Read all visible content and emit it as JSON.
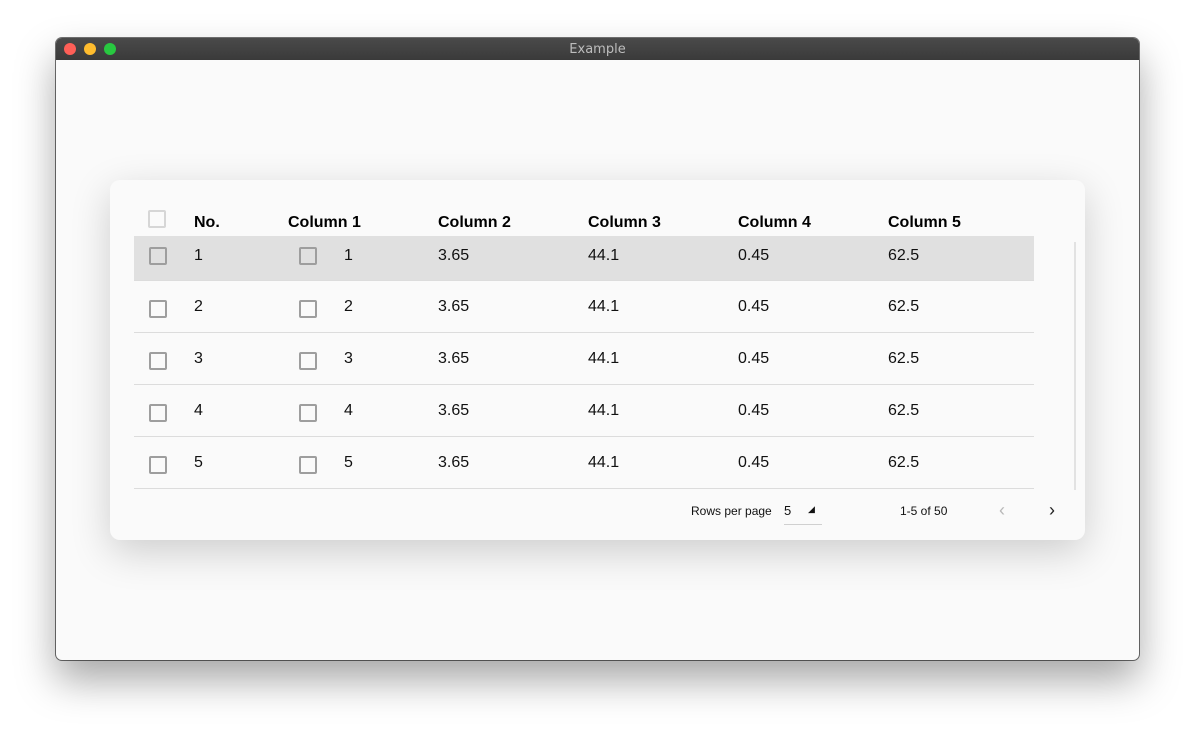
{
  "window": {
    "title": "Example"
  },
  "table": {
    "headers": {
      "no": "No.",
      "c1": "Column 1",
      "c2": "Column 2",
      "c3": "Column 3",
      "c4": "Column 4",
      "c5": "Column 5"
    },
    "rows": [
      {
        "no": "1",
        "c1": "1",
        "c2": "3.65",
        "c3": "44.1",
        "c4": "0.45",
        "c5": "62.5",
        "selected": true
      },
      {
        "no": "2",
        "c1": "2",
        "c2": "3.65",
        "c3": "44.1",
        "c4": "0.45",
        "c5": "62.5"
      },
      {
        "no": "3",
        "c1": "3",
        "c2": "3.65",
        "c3": "44.1",
        "c4": "0.45",
        "c5": "62.5"
      },
      {
        "no": "4",
        "c1": "4",
        "c2": "3.65",
        "c3": "44.1",
        "c4": "0.45",
        "c5": "62.5"
      },
      {
        "no": "5",
        "c1": "5",
        "c2": "3.65",
        "c3": "44.1",
        "c4": "0.45",
        "c5": "62.5"
      }
    ]
  },
  "pagination": {
    "rows_per_page_label": "Rows per page",
    "rows_per_page_value": "5",
    "range": "1-5 of 50",
    "prev_icon": "chevron-left-icon",
    "next_icon": "chevron-right-icon"
  },
  "colors": {
    "selected_row": "#e0e0e0",
    "close": "#fe5f57",
    "minimize": "#febc2e",
    "zoom": "#28c840"
  }
}
